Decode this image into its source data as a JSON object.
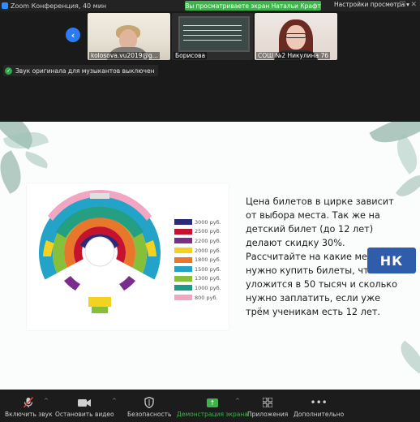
{
  "window": {
    "title": "Zoom Конференция, 40 мин",
    "share_banner": "Вы просматриваете экран Натальи Крафт",
    "view_options": "Настройки просмотра",
    "view_caret": "▾",
    "controls": [
      "—",
      "☐",
      "✕"
    ]
  },
  "gallery": {
    "nav_arrow": "‹",
    "participants": [
      {
        "name": "kolosova.vu2019@g..."
      },
      {
        "name": "Борисова"
      },
      {
        "name": "СОШ №2 Никулина 76"
      }
    ]
  },
  "notification": {
    "text": "Звук оригинала для музыкантов выключен",
    "icon": "shield-check-icon"
  },
  "slide": {
    "legend": [
      {
        "price": "3000 руб.",
        "color": "#2b2a7a"
      },
      {
        "price": "2500 руб.",
        "color": "#c4122f"
      },
      {
        "price": "2200 руб.",
        "color": "#7b2d8e"
      },
      {
        "price": "2000 руб.",
        "color": "#f4d21f"
      },
      {
        "price": "1800 руб.",
        "color": "#e8772c"
      },
      {
        "price": "1500 руб.",
        "color": "#22a3c7"
      },
      {
        "price": "1300 руб.",
        "color": "#86bf3a"
      },
      {
        "price": "1000 руб.",
        "color": "#1b9b8a"
      },
      {
        "price": "800 руб.",
        "color": "#f2a6c4"
      }
    ],
    "task_text": "Цена билетов в цирке зависит от выбора места. Так же на детский билет (до 12 лет) делают скидку 30%. Рассчитайте на какие места нужно купить билеты, чтобы уложится в 50 тысяч и сколько нужно заплатить, если уже трём ученикам есть 12 лет.",
    "logo_text": "НК"
  },
  "toolbar": {
    "items": [
      {
        "label": "Включить звук",
        "icon": "muted-mic-icon"
      },
      {
        "label": "Остановить видео",
        "icon": "video-camera-icon"
      },
      {
        "label": "Безопасность",
        "icon": "security-shield-icon"
      },
      {
        "label": "Демонстрация экрана",
        "icon": "share-screen-icon"
      },
      {
        "label": "Приложения",
        "icon": "apps-icon"
      },
      {
        "label": "Дополнительно",
        "icon": "more-icon"
      }
    ],
    "caret": "^"
  },
  "colors": {
    "zoom_blue": "#2d8cff",
    "share_green": "#3cb44a",
    "toolbar_bg": "#1c1c1c"
  }
}
